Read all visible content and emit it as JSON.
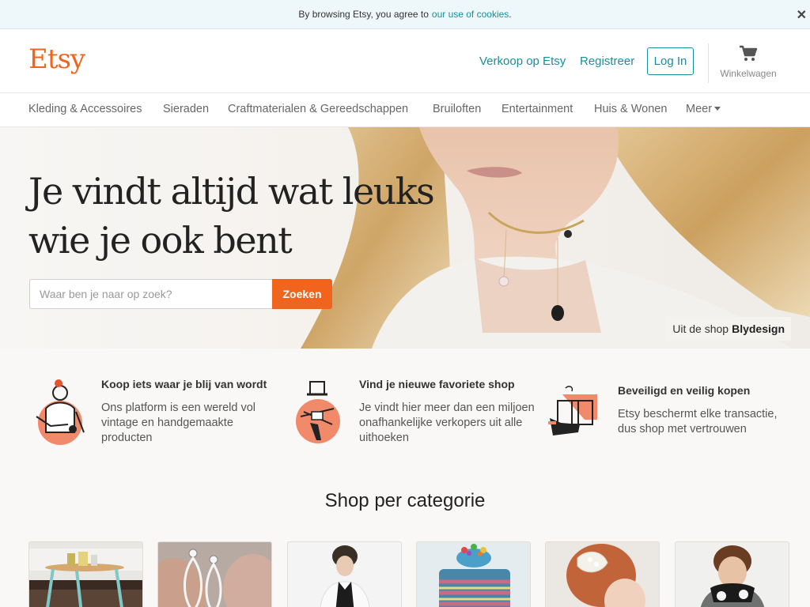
{
  "cookie_bar": {
    "text": "By browsing Etsy, you agree to",
    "link": "our use of cookies",
    "suffix": ".",
    "close_icon": "close-icon"
  },
  "header": {
    "logo": "Etsy",
    "sell_link": "Verkoop op Etsy",
    "register_link": "Registreer",
    "login_button": "Log In",
    "cart_label": "Winkelwagen",
    "cart_icon": "cart-icon",
    "brand_color": "#f1641e",
    "link_color": "#1a8d9b"
  },
  "categories_nav": {
    "items": [
      "Kleding & Accessoires",
      "Sieraden",
      "Craftmaterialen & Gereedschappen",
      "Bruiloften",
      "Entertainment",
      "Huis & Wonen"
    ],
    "more": "Meer"
  },
  "hero": {
    "title_line1": "Je vindt altijd wat leuks",
    "title_line2": "wie je ook bent",
    "search_placeholder": "Waar ben je naar op zoek?",
    "search_button": "Zoeken",
    "credit_prefix": "Uit de shop",
    "credit_shop": "Blydesign"
  },
  "value_props": [
    {
      "icon": "shopping-person-icon",
      "title": "Koop iets waar je blij van wordt",
      "text": "Ons platform is een wereld vol vintage en handgemaakte producten"
    },
    {
      "icon": "knitting-hands-icon",
      "title": "Vind je nieuwe favoriete shop",
      "text": "Je vindt hier meer dan een miljoen onafhankelijke verkopers uit alle uithoeken"
    },
    {
      "icon": "secure-exchange-icon",
      "title": "Beveiligd en veilig kopen",
      "text": "Etsy beschermt elke transactie, dus shop met vertrouwen"
    }
  ],
  "shop_by_category": {
    "title": "Shop per categorie",
    "tiles": [
      "home-decor-tile",
      "jewelry-tile",
      "clothing-tile",
      "craft-supplies-tile",
      "wedding-tile",
      "kids-tile"
    ]
  }
}
